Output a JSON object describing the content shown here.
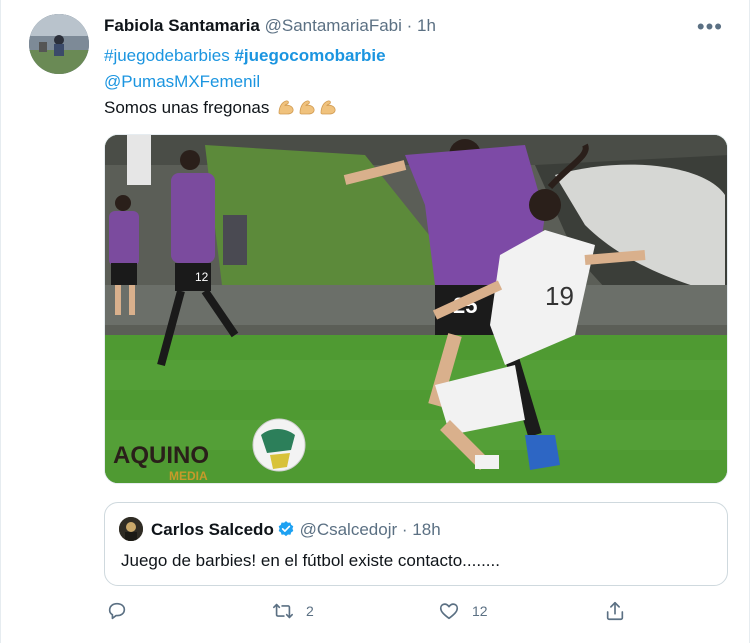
{
  "tweet": {
    "author_name": "Fabiola Santamaria",
    "author_handle": "@SantamariaFabi",
    "separator": "·",
    "time": "1h",
    "more_label": "•••",
    "hashtag1": "#juegodebarbies",
    "hashtag2": "#juegocomobarbie",
    "mention": "@PumasMXFemenil",
    "text": "Somos unas fregonas",
    "emoji": [
      "flexed-biceps-emoji",
      "flexed-biceps-emoji",
      "flexed-biceps-emoji"
    ]
  },
  "media": {
    "watermark_line1": "AQUINO",
    "watermark_line2": "MEDIA",
    "player_number": "19",
    "opponent_number": "25"
  },
  "quote": {
    "author_name": "Carlos Salcedo",
    "author_handle": "@Csalcedojr",
    "separator": "·",
    "time": "18h",
    "text": "Juego de barbies! en el fútbol existe contacto........"
  },
  "actions": {
    "reply_count": "",
    "retweet_count": "2",
    "like_count": "12"
  },
  "colors": {
    "link": "#1b95e0",
    "secondary_text": "#5b7083",
    "verified": "#1da1f2"
  }
}
